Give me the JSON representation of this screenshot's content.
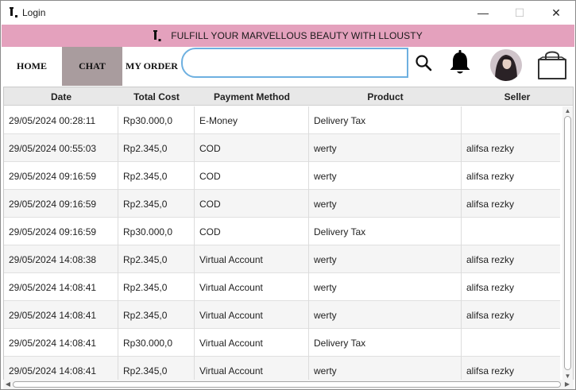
{
  "window": {
    "title": "Login",
    "minimize_glyph": "—",
    "maximize_glyph": "☐",
    "close_glyph": "✕"
  },
  "banner": {
    "text": "FULFILL YOUR MARVELLOUS BEAUTY WITH LLOUSTY",
    "color": "#e4a1bd"
  },
  "nav": {
    "home": "HOME",
    "chat": "CHAT",
    "my_order": "MY ORDER",
    "active_tab": "CHAT",
    "active_color": "#a99c9e"
  },
  "search": {
    "value": "",
    "icon": "search-icon",
    "accent": "#6eb0e0"
  },
  "icons": {
    "notifications": "bell-icon",
    "profile": "avatar",
    "cart": "shopping-bag-icon"
  },
  "table": {
    "columns": [
      "Date",
      "Total Cost",
      "Payment Method",
      "Product",
      "Seller"
    ],
    "rows": [
      [
        "29/05/2024 00:28:11",
        "Rp30.000,0",
        "E-Money",
        "Delivery Tax",
        ""
      ],
      [
        "29/05/2024 00:55:03",
        "Rp2.345,0",
        "COD",
        "werty",
        "alifsa rezky"
      ],
      [
        "29/05/2024 09:16:59",
        "Rp2.345,0",
        "COD",
        "werty",
        "alifsa rezky"
      ],
      [
        "29/05/2024 09:16:59",
        "Rp2.345,0",
        "COD",
        "werty",
        "alifsa rezky"
      ],
      [
        "29/05/2024 09:16:59",
        "Rp30.000,0",
        "COD",
        "Delivery Tax",
        ""
      ],
      [
        "29/05/2024 14:08:38",
        "Rp2.345,0",
        "Virtual Account",
        "werty",
        "alifsa rezky"
      ],
      [
        "29/05/2024 14:08:41",
        "Rp2.345,0",
        "Virtual Account",
        "werty",
        "alifsa rezky"
      ],
      [
        "29/05/2024 14:08:41",
        "Rp2.345,0",
        "Virtual Account",
        "werty",
        "alifsa rezky"
      ],
      [
        "29/05/2024 14:08:41",
        "Rp30.000,0",
        "Virtual Account",
        "Delivery Tax",
        ""
      ],
      [
        "29/05/2024 14:08:41",
        "Rp2.345,0",
        "Virtual Account",
        "werty",
        "alifsa rezky"
      ]
    ]
  }
}
